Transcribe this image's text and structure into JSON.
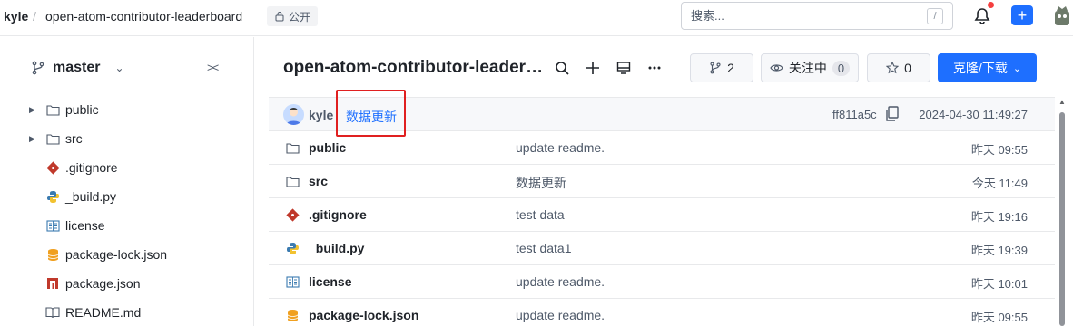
{
  "header": {
    "owner": "kyle",
    "separator": "/",
    "repo": "open-atom-contributor-leaderboard",
    "visibility": "公开",
    "search_placeholder": "搜索...",
    "search_shortcut": "/"
  },
  "sidebar": {
    "branch": "master",
    "collapse_icon": "collapse-icon",
    "tree": [
      {
        "name": "public",
        "type": "folder"
      },
      {
        "name": "src",
        "type": "folder"
      },
      {
        "name": ".gitignore",
        "type": "git"
      },
      {
        "name": "_build.py",
        "type": "python"
      },
      {
        "name": "license",
        "type": "license"
      },
      {
        "name": "package-lock.json",
        "type": "npm-lock"
      },
      {
        "name": "package.json",
        "type": "npm"
      },
      {
        "name": "README.md",
        "type": "readme"
      }
    ]
  },
  "repo_header": {
    "title": "open-atom-contributor-leaderboa...",
    "branch_count": "2",
    "watch_label": "关注中",
    "watch_count": "0",
    "star_count": "0",
    "clone_label": "克隆/下载"
  },
  "latest_commit": {
    "author": "kyle",
    "message": "数据更新",
    "sha": "ff811a5c",
    "time": "2024-04-30 11:49:27"
  },
  "files": [
    {
      "name": "public",
      "type": "folder",
      "message": "update readme.",
      "time": "昨天 09:55"
    },
    {
      "name": "src",
      "type": "folder",
      "message": "数据更新",
      "time": "今天 11:49"
    },
    {
      "name": ".gitignore",
      "type": "git",
      "message": "test data",
      "time": "昨天 19:16"
    },
    {
      "name": "_build.py",
      "type": "python",
      "message": "test data1",
      "time": "昨天 19:39"
    },
    {
      "name": "license",
      "type": "license",
      "message": "update readme.",
      "time": "昨天 10:01"
    },
    {
      "name": "package-lock.json",
      "type": "npm-lock",
      "message": "update readme.",
      "time": "昨天 09:55"
    }
  ],
  "colors": {
    "accent": "#1e6fff",
    "highlight": "#e02020",
    "git": "#c0392b",
    "python": "#3b7bb0",
    "npm_lock": "#f0a020",
    "npm": "#c0392b"
  }
}
